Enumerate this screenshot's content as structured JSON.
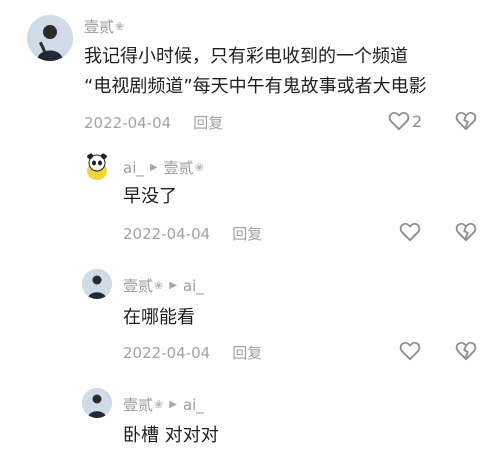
{
  "comments": [
    {
      "author": "壹贰",
      "badge": "❀",
      "lines": [
        "我记得小时候，只有彩电收到的一个频道",
        "“电视剧频道”每天中午有鬼故事或者大电影"
      ],
      "date": "2022-04-04",
      "reply_label": "回复",
      "like_count": "2"
    },
    {
      "author": "ai_",
      "reply_to": "壹贰",
      "reply_to_badge": "❀",
      "arrow": "▶",
      "text": "早没了",
      "date": "2022-04-04",
      "reply_label": "回复"
    },
    {
      "author": "壹贰",
      "badge": "❀",
      "arrow": "▶",
      "reply_to": "ai_",
      "text": "在哪能看",
      "date": "2022-04-04",
      "reply_label": "回复"
    },
    {
      "author": "壹贰",
      "badge": "❀",
      "arrow": "▶",
      "reply_to": "ai_",
      "text": "卧槽 对对对"
    }
  ],
  "icons": {
    "like": "heart-outline-icon",
    "dislike": "broken-heart-icon",
    "avatar_person": "person-avatar",
    "avatar_panda": "panda-avatar"
  },
  "colors": {
    "text_primary": "#1e1e1e",
    "text_secondary": "#9b9b9b",
    "icon": "#8e8e8e"
  }
}
